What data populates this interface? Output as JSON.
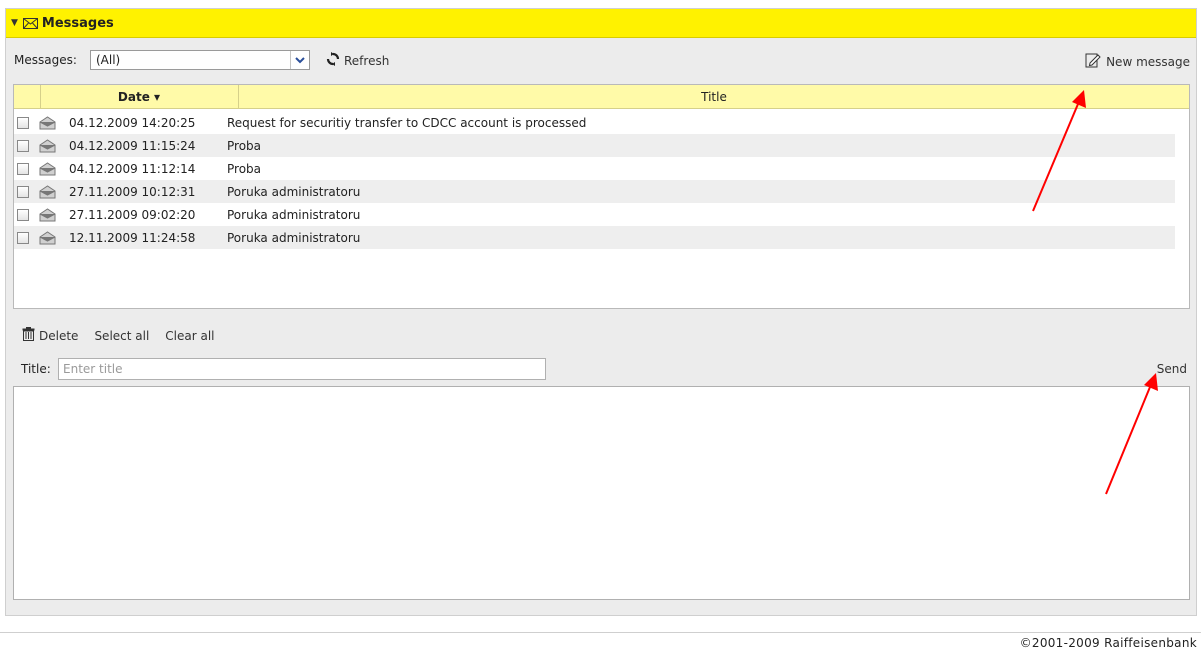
{
  "panel": {
    "title": "Messages",
    "accent": "#fff200"
  },
  "toolbar": {
    "messages_label": "Messages:",
    "filter_value": "(All)",
    "refresh_label": "Refresh",
    "new_message_label": "New message"
  },
  "grid": {
    "columns": [
      "Date ▾",
      "Title"
    ],
    "rows": [
      {
        "date": "04.12.2009 14:20:25",
        "title": "Request for securitiy transfer to CDCC account is processed"
      },
      {
        "date": "04.12.2009 11:15:24",
        "title": "Proba"
      },
      {
        "date": "04.12.2009 11:12:14",
        "title": "Proba"
      },
      {
        "date": "27.11.2009 10:12:31",
        "title": "Poruka administratoru"
      },
      {
        "date": "27.11.2009 09:02:20",
        "title": "Poruka administratoru"
      },
      {
        "date": "12.11.2009 11:24:58",
        "title": "Poruka administratoru"
      }
    ]
  },
  "actions": {
    "delete_label": "Delete",
    "select_all_label": "Select all",
    "clear_all_label": "Clear all"
  },
  "compose": {
    "title_label": "Title:",
    "title_placeholder": "Enter title",
    "send_label": "Send"
  },
  "footer": {
    "copyright": "©2001-2009 Raiffeisenbank"
  },
  "annotation_color": "#ff0000"
}
